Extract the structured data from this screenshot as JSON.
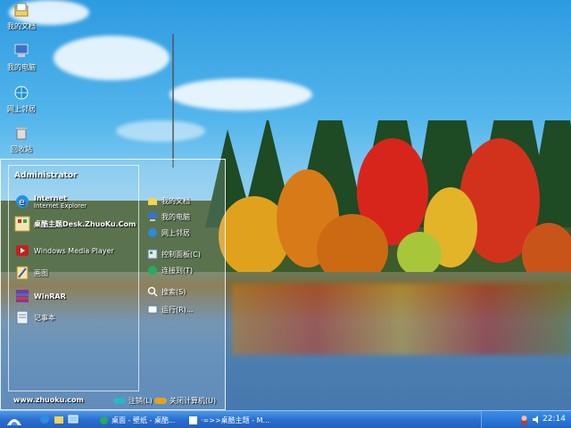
{
  "desktop_icons": [
    {
      "label": "我的文档",
      "icon": "documents-folder-icon"
    },
    {
      "label": "我的电脑",
      "icon": "computer-icon"
    },
    {
      "label": "网上邻居",
      "icon": "network-icon"
    },
    {
      "label": "回收站",
      "icon": "recycle-bin-icon"
    }
  ],
  "start_menu": {
    "user": "Administrator",
    "pinned": [
      {
        "title": "Internet",
        "subtitle": "Internet Explorer"
      },
      {
        "title": "桌酷主题Desk.ZhuoKu.Com",
        "subtitle": ""
      }
    ],
    "programs": [
      {
        "title": "Windows Media Player"
      },
      {
        "title": "画图"
      },
      {
        "title": "WinRAR"
      },
      {
        "title": "记事本"
      }
    ],
    "places": [
      {
        "label": "我的文档"
      },
      {
        "label": "我的电脑"
      },
      {
        "label": "网上邻居"
      },
      {
        "label": "控制面板(C)"
      },
      {
        "label": "连接到(T)"
      },
      {
        "label": "搜索(S)"
      },
      {
        "label": "运行(R)..."
      }
    ],
    "footer_url": "www.zhuoku.com",
    "logoff_label": "注销(L)",
    "shutdown_label": "关闭计算机(U)"
  },
  "taskbar": {
    "tasks": [
      {
        "label": "桌面 - 壁纸 - 桌酷..."
      },
      {
        "label": "·=>>桌酷主题 - M..."
      }
    ],
    "clock": "22:14"
  },
  "colors": {
    "taskbar": "#245fc0",
    "logoff": "#2bb6c8",
    "shutdown": "#e8a020"
  }
}
